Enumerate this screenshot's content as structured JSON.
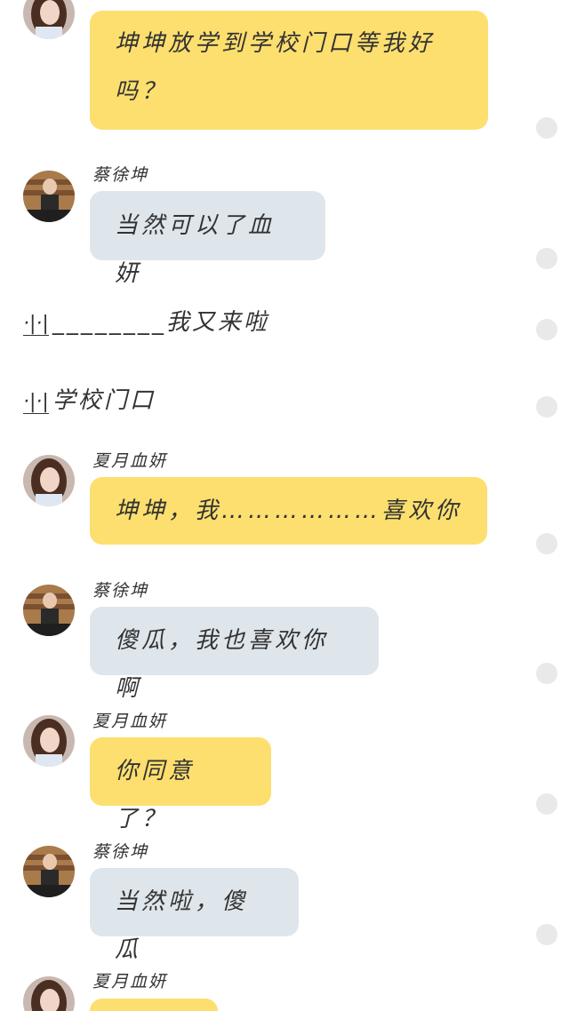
{
  "colors": {
    "bubble_yellow": "#fcdf6e",
    "bubble_gray": "#dfe6eb",
    "select_dot": "#e9e9e9",
    "text": "#333333"
  },
  "messages": [
    {
      "sender": "",
      "avatar": "girl-avatar",
      "text": "坤坤放学到学校门口等我好吗？",
      "line1": "坤坤放学到学校门口等我好",
      "line2": "吗？"
    },
    {
      "sender": "蔡徐坤",
      "avatar": "boy-avatar",
      "text": "当然可以了血妍"
    },
    {
      "narration_mark": "·|·|",
      "text": "________我又来啦"
    },
    {
      "narration_mark": "·|·|",
      "text": "学校门口"
    },
    {
      "sender": "夏月血妍",
      "avatar": "girl-avatar",
      "text": "坤坤，我………………喜欢你"
    },
    {
      "sender": "蔡徐坤",
      "avatar": "boy-avatar",
      "text": "傻瓜，我也喜欢你啊"
    },
    {
      "sender": "夏月血妍",
      "avatar": "girl-avatar",
      "text": "你同意了？"
    },
    {
      "sender": "蔡徐坤",
      "avatar": "boy-avatar",
      "text": "当然啦，傻瓜"
    },
    {
      "sender": "夏月血妍",
      "avatar": "girl-avatar",
      "text": ""
    }
  ]
}
